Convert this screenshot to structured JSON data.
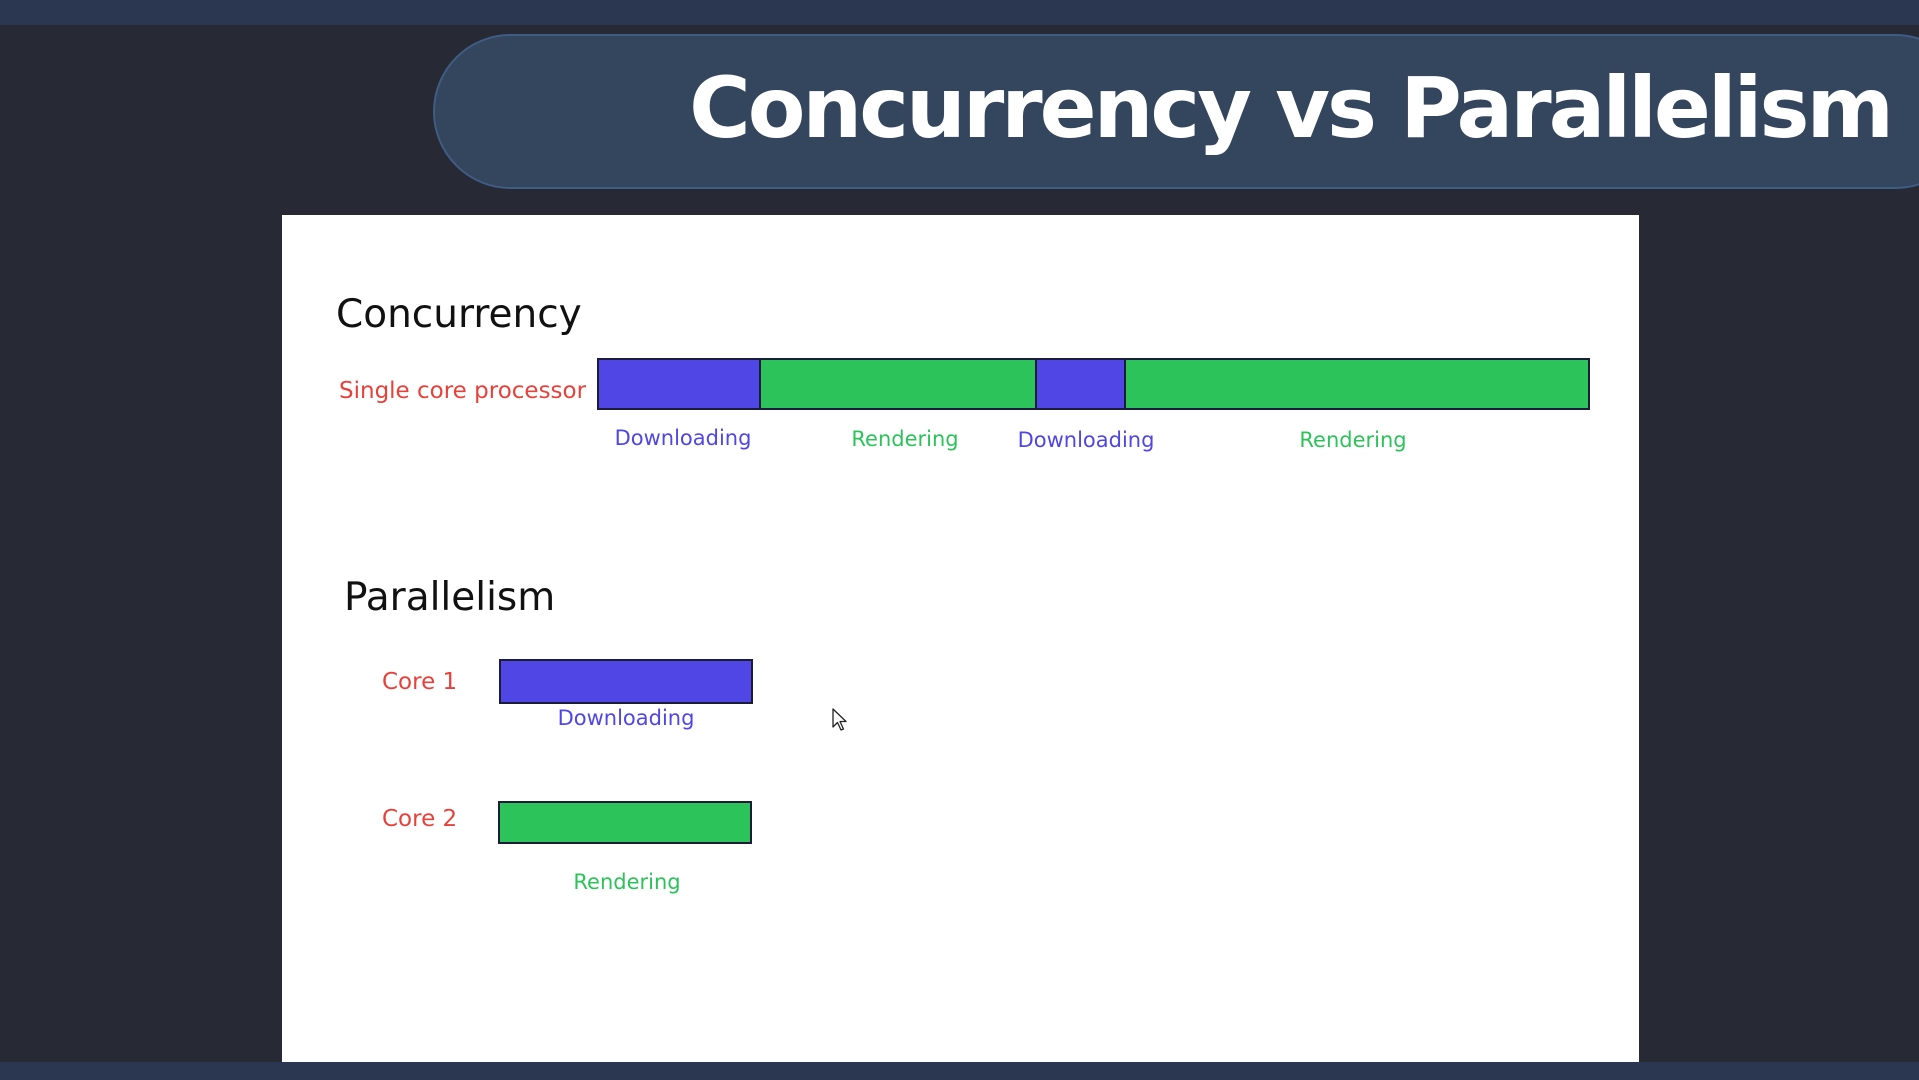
{
  "slide_title": "Concurrency vs Parallelism",
  "colors": {
    "background": "#272a35",
    "band": "#2b3651",
    "title_pill": "#34455e",
    "downloading": "#4f46e5",
    "rendering": "#2cc35a",
    "row_label": "#e8413b"
  },
  "concurrency": {
    "heading": "Concurrency",
    "row_label": "Single core processor",
    "segments": [
      {
        "label": "Downloading",
        "kind": "downloading"
      },
      {
        "label": "Rendering",
        "kind": "rendering"
      },
      {
        "label": "Downloading",
        "kind": "downloading"
      },
      {
        "label": "Rendering",
        "kind": "rendering"
      }
    ]
  },
  "parallelism": {
    "heading": "Parallelism",
    "cores": [
      {
        "label": "Core 1",
        "task": "Downloading",
        "kind": "downloading"
      },
      {
        "label": "Core 2",
        "task": "Rendering",
        "kind": "rendering"
      }
    ]
  },
  "cursor_icon": "mouse-pointer-icon"
}
